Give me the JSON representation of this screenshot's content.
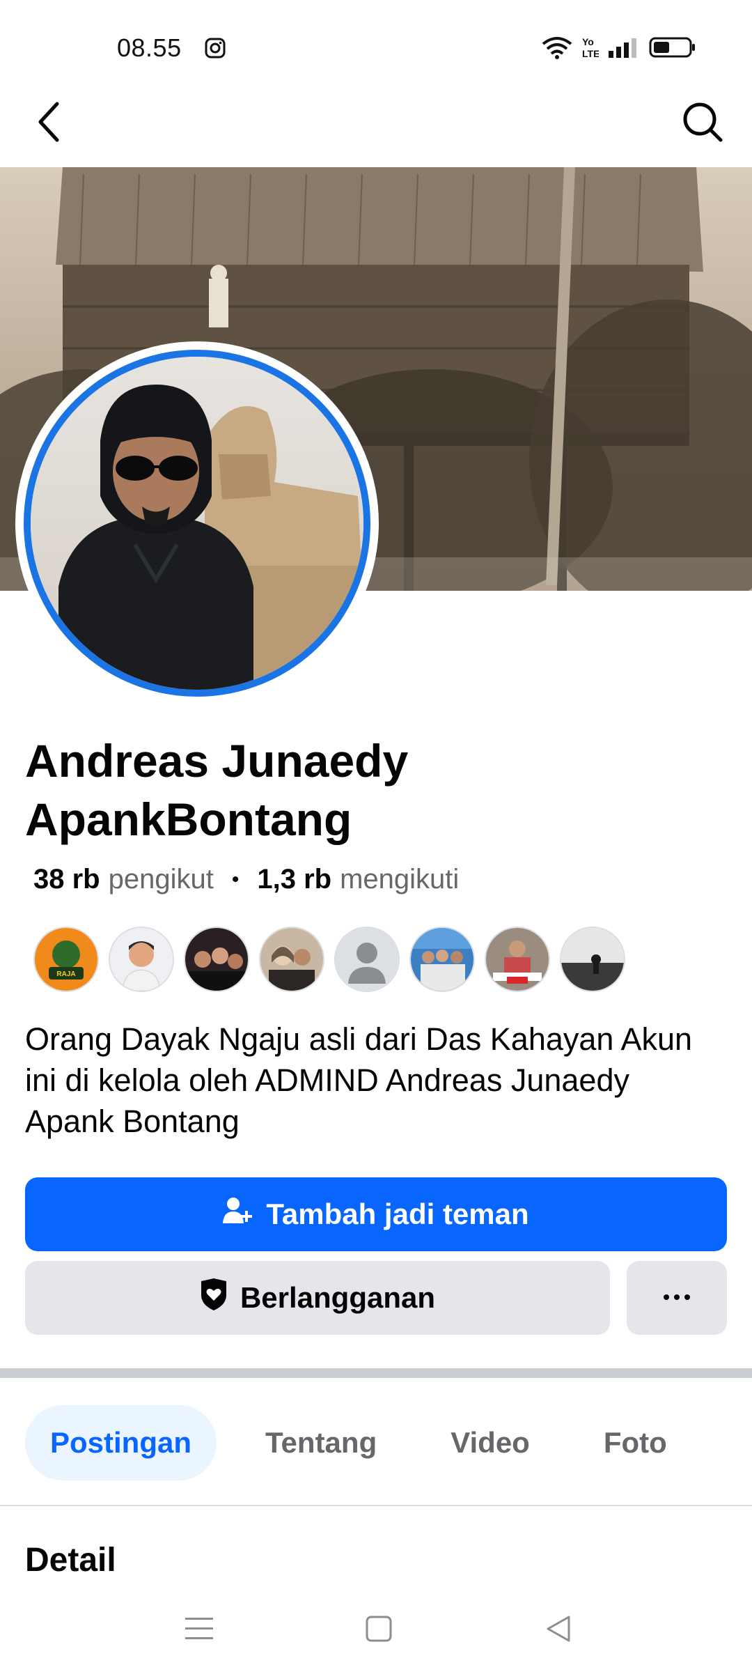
{
  "status_bar": {
    "time": "08.55",
    "icons": [
      "instagram-icon",
      "wifi-icon",
      "volte-icon",
      "signal-icon",
      "battery-icon"
    ]
  },
  "nav": {
    "back_icon": "chevron-left-icon",
    "search_icon": "search-icon"
  },
  "profile": {
    "name": "Andreas Junaedy ApankBontang",
    "followers_count": "38 rb",
    "followers_label": "pengikut",
    "following_count": "1,3 rb",
    "following_label": "mengikuti",
    "bio": "Orang Dayak Ngaju asli dari Das Kahayan Akun ini di kelola oleh ADMIND Andreas Junaedy Apank Bontang"
  },
  "actions": {
    "add_friend_label": "Tambah jadi teman",
    "subscribe_label": "Berlangganan",
    "more_icon": "more-dots-icon"
  },
  "tabs": [
    {
      "label": "Postingan",
      "active": true
    },
    {
      "label": "Tentang",
      "active": false
    },
    {
      "label": "Video",
      "active": false
    },
    {
      "label": "Foto",
      "active": false
    }
  ],
  "section": {
    "detail_title": "Detail"
  },
  "colors": {
    "primary": "#0866ff",
    "avatar_ring": "#1b74e4",
    "secondary_bg": "#e4e6eb",
    "muted_text": "#65676b",
    "active_tab_bg": "#ebf5ff"
  }
}
